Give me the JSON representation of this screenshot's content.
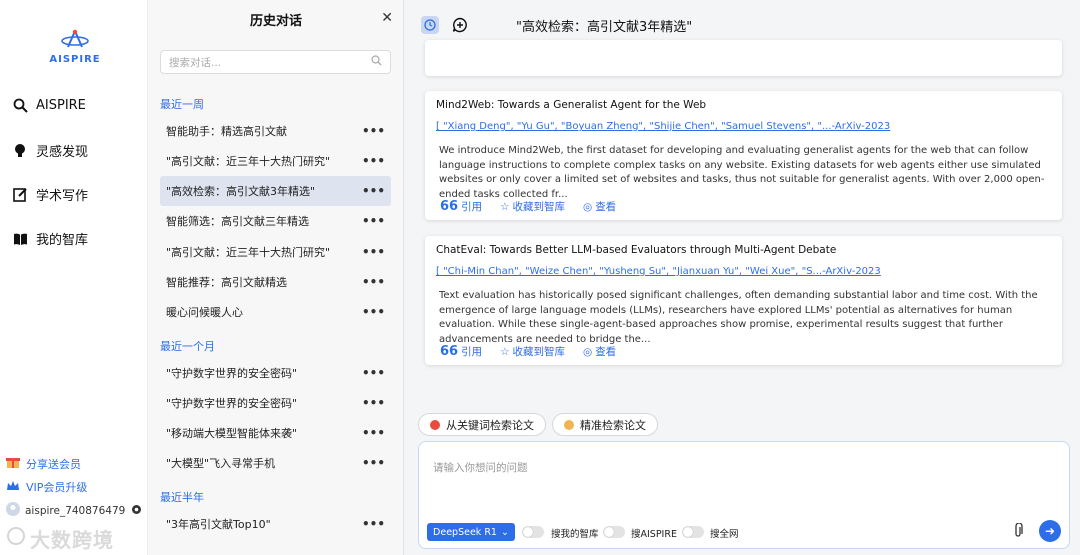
{
  "app": {
    "logo_text": "AISPIRE"
  },
  "nav": {
    "items": [
      {
        "label": "AISPIRE",
        "icon": "search-icon"
      },
      {
        "label": "灵感发现",
        "icon": "bulb-icon"
      },
      {
        "label": "学术写作",
        "icon": "edit-icon"
      },
      {
        "label": "我的智库",
        "icon": "book-icon"
      }
    ],
    "share_label": "分享送会员",
    "vip_label": "VIP会员升级",
    "username": "aispire_740876479",
    "watermark": "大数跨境"
  },
  "history": {
    "title": "历史对话",
    "search_placeholder": "搜索对话...",
    "groups": [
      {
        "label": "最近一周"
      },
      {
        "label": "最近一个月"
      },
      {
        "label": "最近半年"
      }
    ],
    "items": [
      "智能助手：精选高引文献",
      "\"高引文献：近三年十大热门研究\"",
      "\"高效检索：高引文献3年精选\"",
      "智能筛选：高引文献三年精选",
      "\"高引文献：近三年十大热门研究\"",
      "智能推荐：高引文献精选",
      "暖心问候暖人心",
      "\"守护数字世界的安全密码\"",
      "\"守护数字世界的安全密码\"",
      "\"移动端大模型智能体来袭\"",
      "\"大模型\"飞入寻常手机",
      "\"3年高引文献Top10\""
    ],
    "active_index": 2,
    "more_glyph": "•••"
  },
  "main": {
    "title": "\"高效检索：高引文献3年精选\"",
    "cards": [
      {
        "title": "Mind2Web: Towards a Generalist Agent for the Web",
        "authors": "[ \"Xiang Deng\", \"Yu Gu\", \"Boyuan Zheng\", \"Shijie Chen\", \"Samuel Stevens\", \"...",
        "source": "-ArXiv-2023",
        "abstract": "We introduce Mind2Web, the first dataset for developing and evaluating generalist agents for the web that can follow language instructions to complete complex tasks on any website. Existing datasets for web agents either use simulated websites or only cover a limited set of websites and tasks, thus not suitable for generalist agents. With over 2,000 open-ended tasks collected fr..."
      },
      {
        "title": "ChatEval: Towards Better LLM-based Evaluators through Multi-Agent Debate",
        "authors": "[ \"Chi-Min Chan\", \"Weize Chen\", \"Yusheng Su\", \"Jianxuan Yu\", \"Wei Xue\", \"S...",
        "source": "-ArXiv-2023",
        "abstract": "Text evaluation has historically posed significant challenges, often demanding substantial labor and time cost. With the emergence of large language models (LLMs), researchers have explored LLMs' potential as alternatives for human evaluation. While these single-agent-based approaches show promise, experimental results suggest that further advancements are needed to bridge the..."
      }
    ],
    "actions": {
      "cite": "引用",
      "save": "收藏到智库",
      "view": "查看"
    },
    "chips": [
      {
        "label": "从关键词检索论文",
        "color": "#e84c3d"
      },
      {
        "label": "精准检索论文",
        "color": "#f0b455"
      }
    ],
    "input": {
      "placeholder": "请输入你想问的问题",
      "model": "DeepSeek R1",
      "toggles": [
        "搜我的智库",
        "搜AISPIRE",
        "搜全网"
      ]
    }
  }
}
